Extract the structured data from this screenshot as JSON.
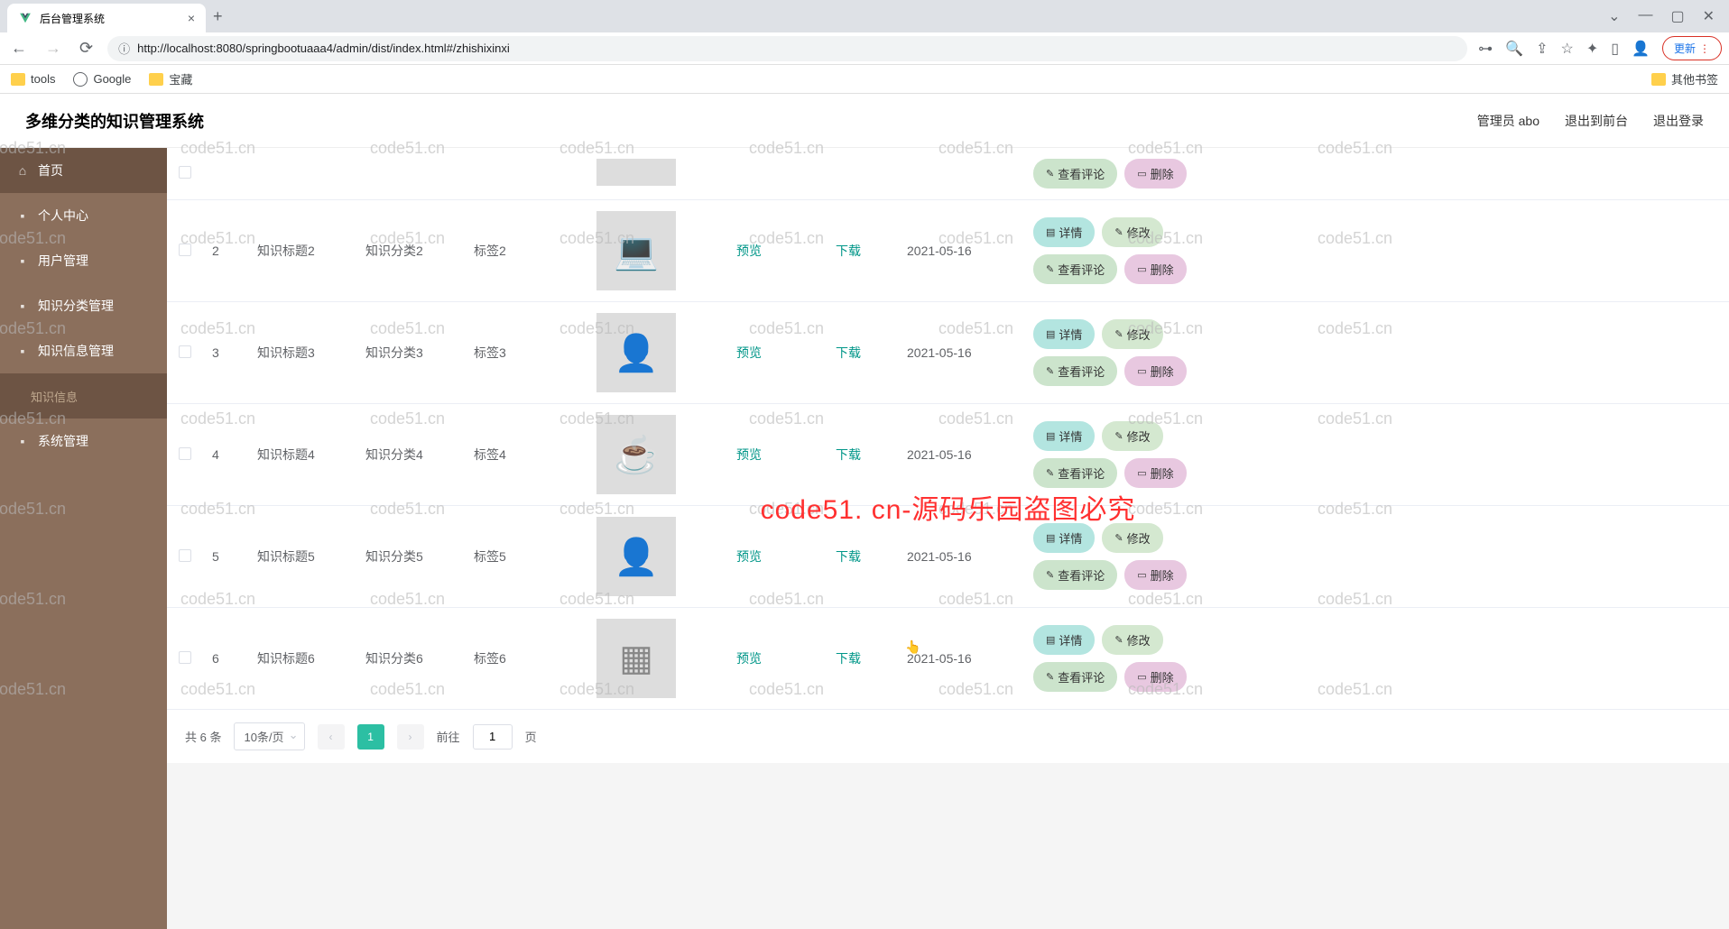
{
  "browser": {
    "tab_title": "后台管理系统",
    "url": "http://localhost:8080/springbootuaaa4/admin/dist/index.html#/zhishixinxi",
    "update_label": "更新"
  },
  "bookmarks": {
    "tools": "tools",
    "google": "Google",
    "treasure": "宝藏",
    "other": "其他书签"
  },
  "header": {
    "title": "多维分类的知识管理系统",
    "admin": "管理员 abo",
    "to_front": "退出到前台",
    "logout": "退出登录"
  },
  "sidebar": {
    "home": "首页",
    "personal": "个人中心",
    "user_mgmt": "用户管理",
    "category_mgmt": "知识分类管理",
    "info_mgmt": "知识信息管理",
    "info_sub": "知识信息",
    "system": "系统管理"
  },
  "table": {
    "rows": [
      {
        "id": "",
        "title": "",
        "cat": "",
        "tag": "",
        "preview": "",
        "download": "",
        "date": "",
        "img_label": "",
        "partial": true
      },
      {
        "id": "2",
        "title": "知识标题2",
        "cat": "知识分类2",
        "tag": "标签2",
        "preview": "预览",
        "download": "下载",
        "date": "2021-05-16",
        "img_label": "💻"
      },
      {
        "id": "3",
        "title": "知识标题3",
        "cat": "知识分类3",
        "tag": "标签3",
        "preview": "预览",
        "download": "下载",
        "date": "2021-05-16",
        "img_label": "👤"
      },
      {
        "id": "4",
        "title": "知识标题4",
        "cat": "知识分类4",
        "tag": "标签4",
        "preview": "预览",
        "download": "下载",
        "date": "2021-05-16",
        "img_label": "☕"
      },
      {
        "id": "5",
        "title": "知识标题5",
        "cat": "知识分类5",
        "tag": "标签5",
        "preview": "预览",
        "download": "下载",
        "date": "2021-05-16",
        "img_label": "👤"
      },
      {
        "id": "6",
        "title": "知识标题6",
        "cat": "知识分类6",
        "tag": "标签6",
        "preview": "预览",
        "download": "下载",
        "date": "2021-05-16",
        "img_label": "▦"
      }
    ]
  },
  "actions": {
    "detail": "详情",
    "edit": "修改",
    "comment": "查看评论",
    "delete": "删除"
  },
  "pagination": {
    "total": "共 6 条",
    "page_size": "10条/页",
    "current": "1",
    "goto_pre": "前往",
    "goto_val": "1",
    "goto_suf": "页"
  },
  "watermark": {
    "text": "code51.cn",
    "center": "code51. cn-源码乐园盗图必究"
  }
}
